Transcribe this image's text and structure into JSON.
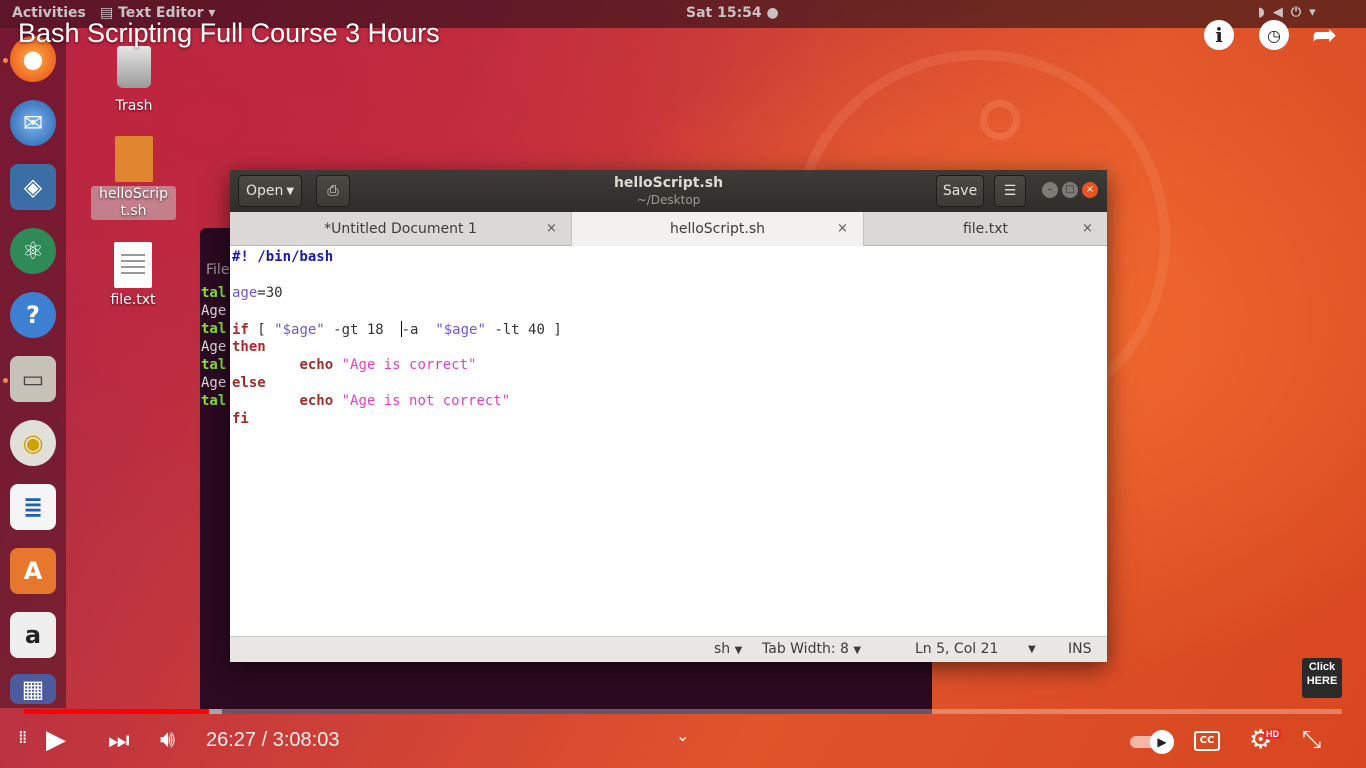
{
  "top_panel": {
    "activities": "Activities",
    "app_menu": "Text Editor",
    "clock": "Sat 15:54"
  },
  "video": {
    "title": "Bash Scripting Full Course 3 Hours",
    "current_time": "26:27",
    "duration": "3:08:03",
    "time_display": "26:27 / 3:08:03",
    "progress_played": 0.14,
    "progress_loaded": 0.15,
    "cta_line1": "Click",
    "cta_line2": "HERE",
    "hd": "HD"
  },
  "desktop": {
    "trash": "Trash",
    "script_file": "helloScript.sh",
    "file_txt": "file.txt"
  },
  "terminal": {
    "lines": [
      "File",
      "tal",
      "Age",
      "tal",
      "Age",
      "tal",
      "Age",
      "tal"
    ]
  },
  "editor": {
    "open_label": "Open",
    "save_label": "Save",
    "title": "helloScript.sh",
    "subtitle": "~/Desktop",
    "tabs": [
      {
        "label": "*Untitled Document 1"
      },
      {
        "label": "helloScript.sh",
        "active": true
      },
      {
        "label": "file.txt"
      }
    ],
    "code": {
      "l1": "#! /bin/bash",
      "l3_var": "age",
      "l3_rest": "=30",
      "l5_if": "if",
      "l5_a": " [ ",
      "l5_s1": "\"$age\"",
      "l5_b": " -gt 18  ",
      "l5_c": "-a  ",
      "l5_s2": "\"$age\"",
      "l5_d": " -lt 40 ]",
      "l6": "then",
      "l7_indent": "        ",
      "l7_echo": "echo",
      "l7_str": "\"Age is correct\"",
      "l8": "else",
      "l9_echo": "echo",
      "l9_str": "\"Age is not correct\"",
      "l10": "fi"
    },
    "status": {
      "language": "sh",
      "tab_width": "Tab Width: 8",
      "position": "Ln 5, Col 21",
      "mode": "INS"
    }
  },
  "colors": {
    "accent_red": "#ff0000",
    "header_bg": "#3c3b37",
    "close_btn": "#e95420"
  }
}
